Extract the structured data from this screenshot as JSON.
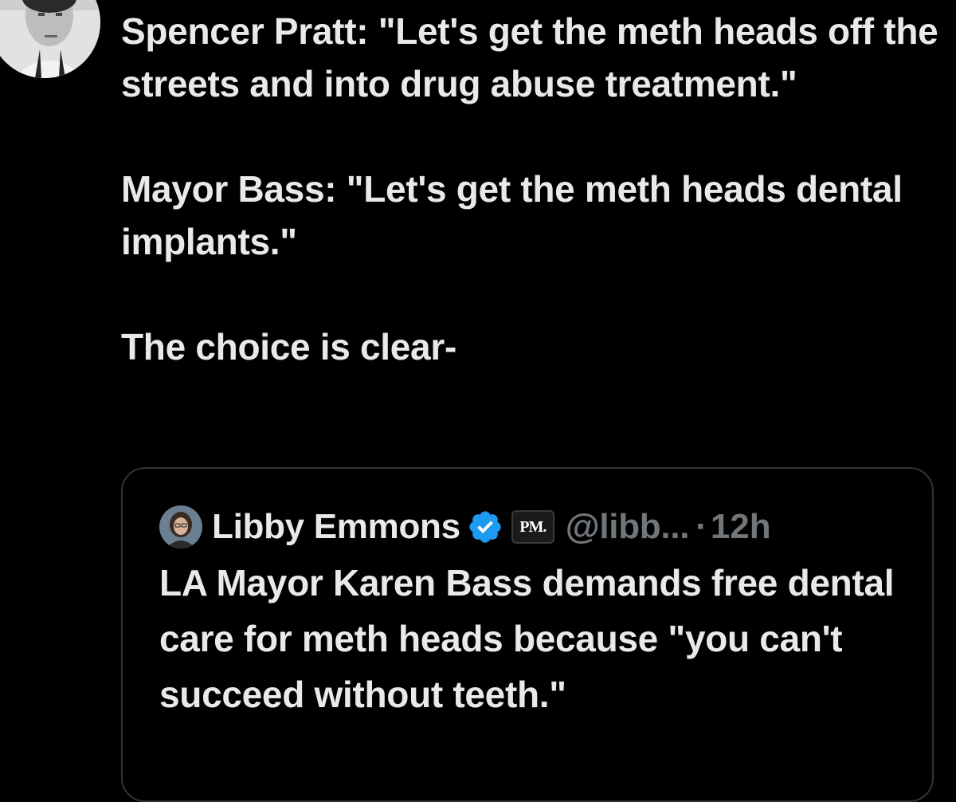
{
  "author": {
    "avatar_icon": "profile-photo"
  },
  "tweet": {
    "paragraphs": [
      "Spencer Pratt:  \"Let's get the meth heads off the streets and into drug abuse treatment.\"",
      "Mayor Bass:  \"Let's get the meth heads dental implants.\"",
      "The choice is clear-"
    ]
  },
  "quote": {
    "name": "Libby Emmons",
    "verified_icon": "verified-badge-icon",
    "verified_color": "#1d9bf0",
    "affiliate_badge": "PM.",
    "handle": "@libb...",
    "separator": "·",
    "time": "12h",
    "text": "LA Mayor Karen Bass demands free dental care for meth heads because \"you can't succeed without teeth.\""
  },
  "colors": {
    "background": "#000000",
    "text": "#e7e9ea",
    "muted": "#71767b",
    "border": "#2f3336"
  }
}
